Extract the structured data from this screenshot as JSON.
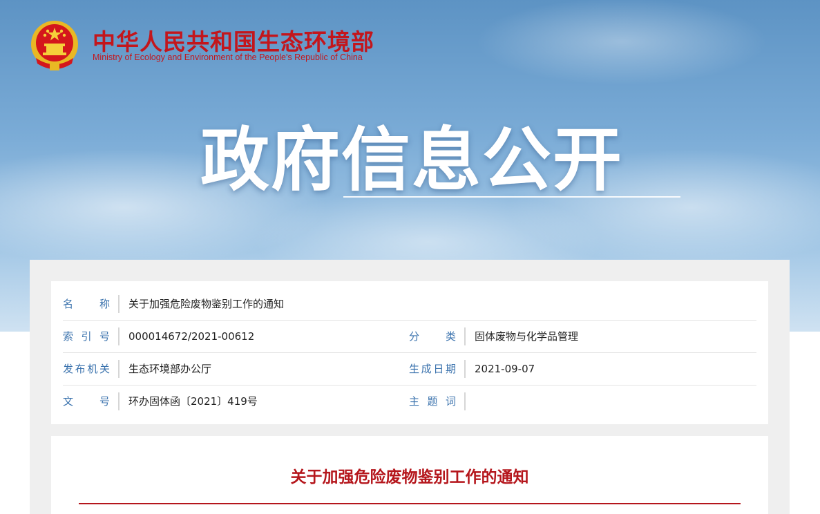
{
  "header": {
    "site_name_cn": "中华人民共和国生态环境部",
    "site_name_en": "Ministry of Ecology and Environment of the People's Republic of China",
    "emblem_icon": "national-emblem-icon"
  },
  "banner": {
    "heading": "政府信息公开"
  },
  "meta": {
    "name_label": "名　　称",
    "name_value": "关于加强危险废物鉴别工作的通知",
    "index_label": "索 引 号",
    "index_value": "000014672/2021-00612",
    "category_label": "分　　类",
    "category_value": "固体废物与化学品管理",
    "issuer_label": "发布机关",
    "issuer_value": "生态环境部办公厅",
    "date_label": "生成日期",
    "date_value": "2021-09-07",
    "docno_label": "文　　号",
    "docno_value": "环办固体函〔2021〕419号",
    "keywords_label": "主 题 词",
    "keywords_value": ""
  },
  "document": {
    "title": "关于加强危险废物鉴别工作的通知"
  },
  "colors": {
    "brand_red": "#c3161c",
    "label_blue": "#3a72ad"
  }
}
